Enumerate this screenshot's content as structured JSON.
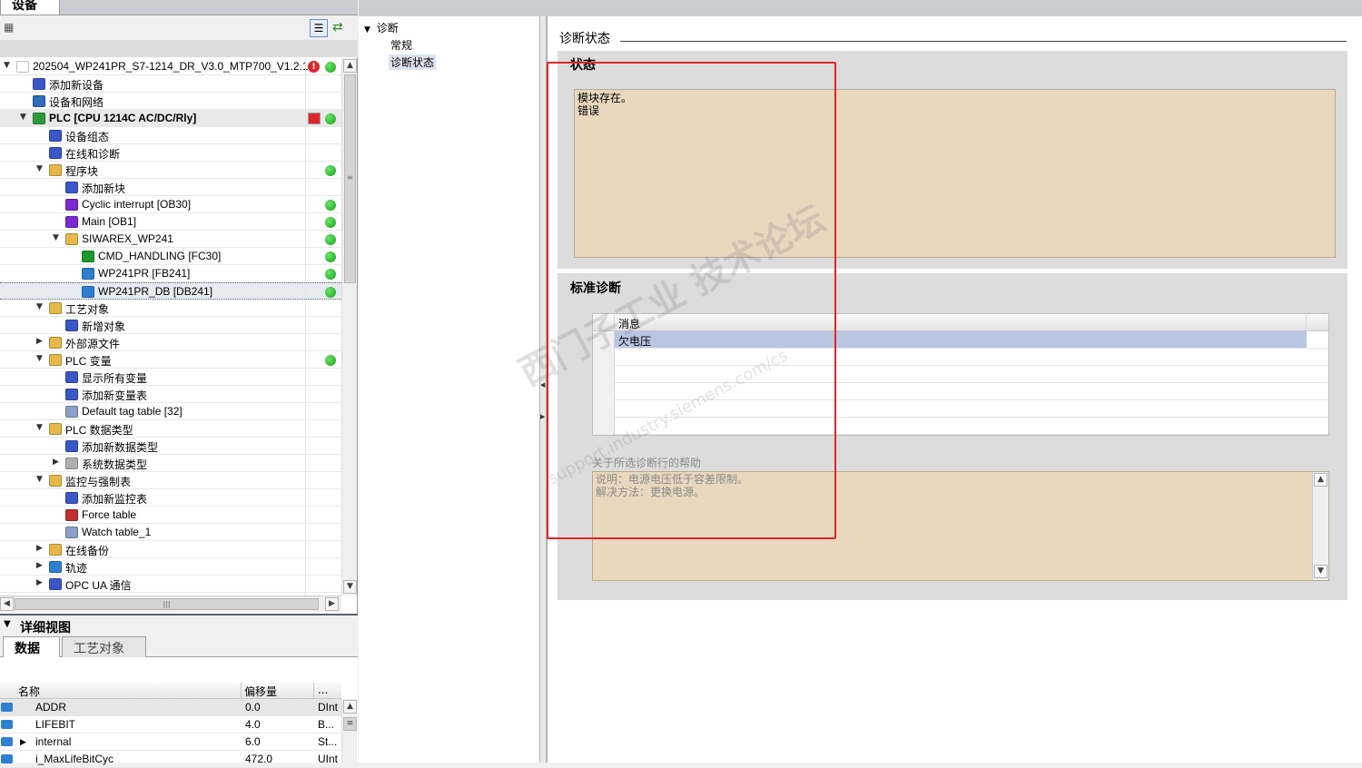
{
  "left_panel": {
    "tab_label": "设备",
    "tree": [
      {
        "label": "202504_WP241PR_S7-1214_DR_V3.0_MTP700_V1.2.1...",
        "level": 0,
        "expander": "open",
        "icon": "project-icon",
        "icon_color": "#ffffff",
        "status": "error-and-ok"
      },
      {
        "label": "添加新设备",
        "level": 1,
        "expander": "none",
        "icon": "add-device-icon",
        "icon_color": "#3a57c8",
        "status": "none"
      },
      {
        "label": "设备和网络",
        "level": 1,
        "expander": "none",
        "icon": "network-icon",
        "icon_color": "#2f6db8",
        "status": "none"
      },
      {
        "label": "PLC [CPU 1214C AC/DC/Rly]",
        "level": 1,
        "expander": "open",
        "icon": "plc-icon",
        "icon_color": "#2c9a3a",
        "status": "download-and-ok",
        "header": true
      },
      {
        "label": "设备组态",
        "level": 2,
        "expander": "none",
        "icon": "device-config-icon",
        "icon_color": "#3a57c8",
        "status": "none"
      },
      {
        "label": "在线和诊断",
        "level": 2,
        "expander": "none",
        "icon": "online-diag-icon",
        "icon_color": "#3a57c8",
        "status": "none"
      },
      {
        "label": "程序块",
        "level": 2,
        "expander": "open",
        "icon": "folder-icon",
        "icon_color": "#e6b84a",
        "status": "ok"
      },
      {
        "label": "添加新块",
        "level": 3,
        "expander": "none",
        "icon": "add-block-icon",
        "icon_color": "#3a57c8",
        "status": "none"
      },
      {
        "label": "Cyclic interrupt [OB30]",
        "level": 3,
        "expander": "none",
        "icon": "ob-icon",
        "icon_color": "#7a2ad0",
        "status": "ok"
      },
      {
        "label": "Main [OB1]",
        "level": 3,
        "expander": "none",
        "icon": "ob-icon",
        "icon_color": "#7a2ad0",
        "status": "ok"
      },
      {
        "label": "SIWAREX_WP241",
        "level": 3,
        "expander": "open",
        "icon": "folder-icon",
        "icon_color": "#e6b84a",
        "status": "ok"
      },
      {
        "label": "CMD_HANDLING [FC30]",
        "level": 4,
        "expander": "none",
        "icon": "fc-icon",
        "icon_color": "#1e9a2c",
        "status": "ok"
      },
      {
        "label": "WP241PR [FB241]",
        "level": 4,
        "expander": "none",
        "icon": "fb-icon",
        "icon_color": "#2f7fd0",
        "status": "ok"
      },
      {
        "label": "WP241PR_DB [DB241]",
        "level": 4,
        "expander": "none",
        "icon": "db-icon",
        "icon_color": "#2f7fd0",
        "status": "ok",
        "selected": true
      },
      {
        "label": "工艺对象",
        "level": 2,
        "expander": "open",
        "icon": "tech-object-icon",
        "icon_color": "#e6b84a",
        "status": "none"
      },
      {
        "label": "新增对象",
        "level": 3,
        "expander": "none",
        "icon": "add-object-icon",
        "icon_color": "#3a57c8",
        "status": "none"
      },
      {
        "label": "外部源文件",
        "level": 2,
        "expander": "closed",
        "icon": "external-source-icon",
        "icon_color": "#e6b84a",
        "status": "none"
      },
      {
        "label": "PLC 变量",
        "level": 2,
        "expander": "open",
        "icon": "plc-tags-icon",
        "icon_color": "#e6b84a",
        "status": "ok"
      },
      {
        "label": "显示所有变量",
        "level": 3,
        "expander": "none",
        "icon": "show-tags-icon",
        "icon_color": "#3a57c8",
        "status": "none"
      },
      {
        "label": "添加新变量表",
        "level": 3,
        "expander": "none",
        "icon": "add-tag-table-icon",
        "icon_color": "#3a57c8",
        "status": "none"
      },
      {
        "label": "Default tag table [32]",
        "level": 3,
        "expander": "none",
        "icon": "tag-table-icon",
        "icon_color": "#8aa0c8",
        "status": "none"
      },
      {
        "label": "PLC 数据类型",
        "level": 2,
        "expander": "open",
        "icon": "data-types-icon",
        "icon_color": "#e6b84a",
        "status": "none"
      },
      {
        "label": "添加新数据类型",
        "level": 3,
        "expander": "none",
        "icon": "add-data-type-icon",
        "icon_color": "#3a57c8",
        "status": "none"
      },
      {
        "label": "系统数据类型",
        "level": 3,
        "expander": "closed",
        "icon": "system-data-type-icon",
        "icon_color": "#b0b0b0",
        "status": "none"
      },
      {
        "label": "监控与强制表",
        "level": 2,
        "expander": "open",
        "icon": "watch-force-icon",
        "icon_color": "#e6b84a",
        "status": "none"
      },
      {
        "label": "添加新监控表",
        "level": 3,
        "expander": "none",
        "icon": "add-watch-table-icon",
        "icon_color": "#3a57c8",
        "status": "none"
      },
      {
        "label": "Force table",
        "level": 3,
        "expander": "none",
        "icon": "force-table-icon",
        "icon_color": "#c03030",
        "status": "none"
      },
      {
        "label": "Watch table_1",
        "level": 3,
        "expander": "none",
        "icon": "watch-table-icon",
        "icon_color": "#8aa0c8",
        "status": "none"
      },
      {
        "label": "在线备份",
        "level": 2,
        "expander": "closed",
        "icon": "online-backup-icon",
        "icon_color": "#e6b84a",
        "status": "none"
      },
      {
        "label": "轨迹",
        "level": 2,
        "expander": "closed",
        "icon": "trace-icon",
        "icon_color": "#2f7fd0",
        "status": "none"
      },
      {
        "label": "OPC UA 通信",
        "level": 2,
        "expander": "closed",
        "icon": "opcua-icon",
        "icon_color": "#3a57c8",
        "status": "none"
      }
    ]
  },
  "detail_view": {
    "title": "详细视图",
    "tabs": [
      "数据",
      "工艺对象"
    ],
    "columns": [
      "名称",
      "偏移量",
      "..."
    ],
    "rows": [
      {
        "name": "ADDR",
        "offset": "0.0",
        "type": "DInt",
        "expander": false
      },
      {
        "name": "LIFEBIT",
        "offset": "4.0",
        "type": "B...",
        "expander": false
      },
      {
        "name": "internal",
        "offset": "6.0",
        "type": "St...",
        "expander": true
      },
      {
        "name": "i_MaxLifeBitCyc",
        "offset": "472.0",
        "type": "UInt",
        "expander": false
      }
    ]
  },
  "middle_nav": {
    "root": "诊断",
    "items": [
      "常规",
      "诊断状态"
    ]
  },
  "right_panel": {
    "section_title": "诊断状态",
    "status_title": "状态",
    "status_lines": [
      "模块存在。",
      "错误"
    ],
    "std_diag_title": "标准诊断",
    "table_header": "消息",
    "table_rows": [
      "欠电压",
      "",
      "",
      "",
      "",
      ""
    ],
    "help_label": "关于所选诊断行的帮助",
    "help_lines": [
      "说明：电源电压低于容差限制。",
      "解决方法：更换电源。"
    ]
  },
  "watermark": {
    "line1": "西门子工业 技术论坛",
    "line2": "support.industry.siemens.com/cs"
  },
  "colors": {
    "status_ok": "#11a411",
    "status_error": "#e0262a",
    "annotation_red": "#e0262a",
    "yellow_box": "#e8d8bd",
    "selection": "#b9c6e2"
  }
}
